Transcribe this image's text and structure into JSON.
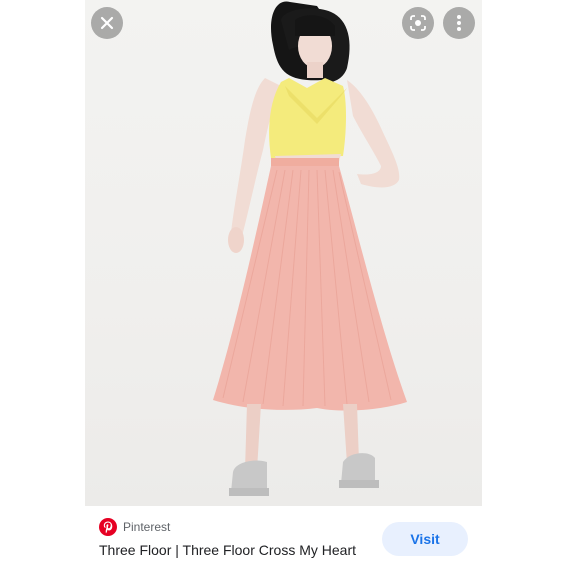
{
  "viewer": {
    "buttons": {
      "close_icon": "close-icon",
      "lens_icon": "google-lens-icon",
      "more_icon": "more-vertical-icon"
    },
    "image": {
      "colors": {
        "background": "#f0efed",
        "top": "#f4eb7c",
        "skirt": "#f2b6ac",
        "hair": "#151515",
        "skin": "#f1dcd4",
        "sandals": "#c8c8c8"
      }
    }
  },
  "result": {
    "source_icon": "pinterest-logo-icon",
    "source_name": "Pinterest",
    "title": "Three Floor | Three Floor Cross My Heart",
    "visit_label": "Visit",
    "accent": "#1a73e8",
    "brand_color": "#e60023"
  }
}
